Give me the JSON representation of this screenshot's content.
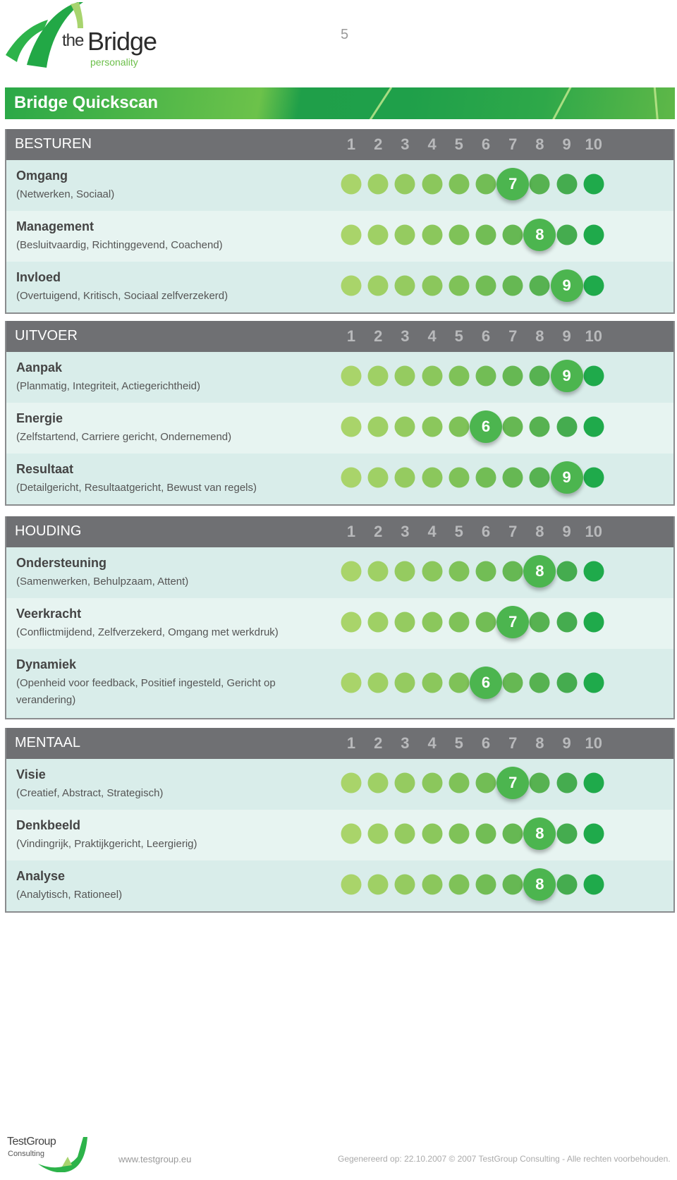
{
  "header": {
    "logo": {
      "the": "the",
      "bridge": "Bridge",
      "tagline": "personality",
      "icon": "bridge-arc-logo-icon"
    },
    "page_number": "5"
  },
  "banner": {
    "title": "Bridge Quickscan"
  },
  "scale": [
    "1",
    "2",
    "3",
    "4",
    "5",
    "6",
    "7",
    "8",
    "9",
    "10"
  ],
  "colors": {
    "section_header": "#6f7073",
    "row_odd": "#d9edea",
    "row_even": "#e7f4f1",
    "dot_scale": [
      "#a9d46a",
      "#9fd065",
      "#95cb60",
      "#8bc75c",
      "#7fc258",
      "#72bd55",
      "#66b853",
      "#57b251",
      "#45ac4f",
      "#1faa4b"
    ],
    "selected_dot": "#4cb54f"
  },
  "sections": [
    {
      "name": "BESTUREN",
      "rows": [
        {
          "label": "Omgang",
          "desc": "(Netwerken, Sociaal)",
          "score": 7
        },
        {
          "label": "Management",
          "desc": "(Besluitvaardig, Richtinggevend, Coachend)",
          "score": 8
        },
        {
          "label": "Invloed",
          "desc": "(Overtuigend, Kritisch, Sociaal zelfverzekerd)",
          "score": 9
        }
      ]
    },
    {
      "name": "UITVOER",
      "rows": [
        {
          "label": "Aanpak",
          "desc": "(Planmatig, Integriteit, Actiegerichtheid)",
          "score": 9
        },
        {
          "label": "Energie",
          "desc": "(Zelfstartend, Carriere gericht, Ondernemend)",
          "score": 6
        },
        {
          "label": "Resultaat",
          "desc": "(Detailgericht, Resultaatgericht, Bewust van regels)",
          "score": 9
        }
      ]
    },
    {
      "name": "HOUDING",
      "rows": [
        {
          "label": "Ondersteuning",
          "desc": "(Samenwerken, Behulpzaam, Attent)",
          "score": 8
        },
        {
          "label": "Veerkracht",
          "desc": "(Conflictmijdend, Zelfverzekerd, Omgang met werkdruk)",
          "score": 7
        },
        {
          "label": "Dynamiek",
          "desc": "(Openheid voor feedback, Positief ingesteld, Gericht op verandering)",
          "score": 6
        }
      ]
    },
    {
      "name": "MENTAAL",
      "rows": [
        {
          "label": "Visie",
          "desc": "(Creatief, Abstract, Strategisch)",
          "score": 7
        },
        {
          "label": "Denkbeeld",
          "desc": "(Vindingrijk, Praktijkgericht, Leergierig)",
          "score": 8
        },
        {
          "label": "Analyse",
          "desc": "(Analytisch, Rationeel)",
          "score": 8
        }
      ]
    }
  ],
  "footer": {
    "company_line1": "TestGroup",
    "company_line2": "Consulting",
    "url": "www.testgroup.eu",
    "copyright": "Gegenereerd op: 22.10.2007 © 2007 TestGroup Consulting - Alle rechten voorbehouden."
  }
}
